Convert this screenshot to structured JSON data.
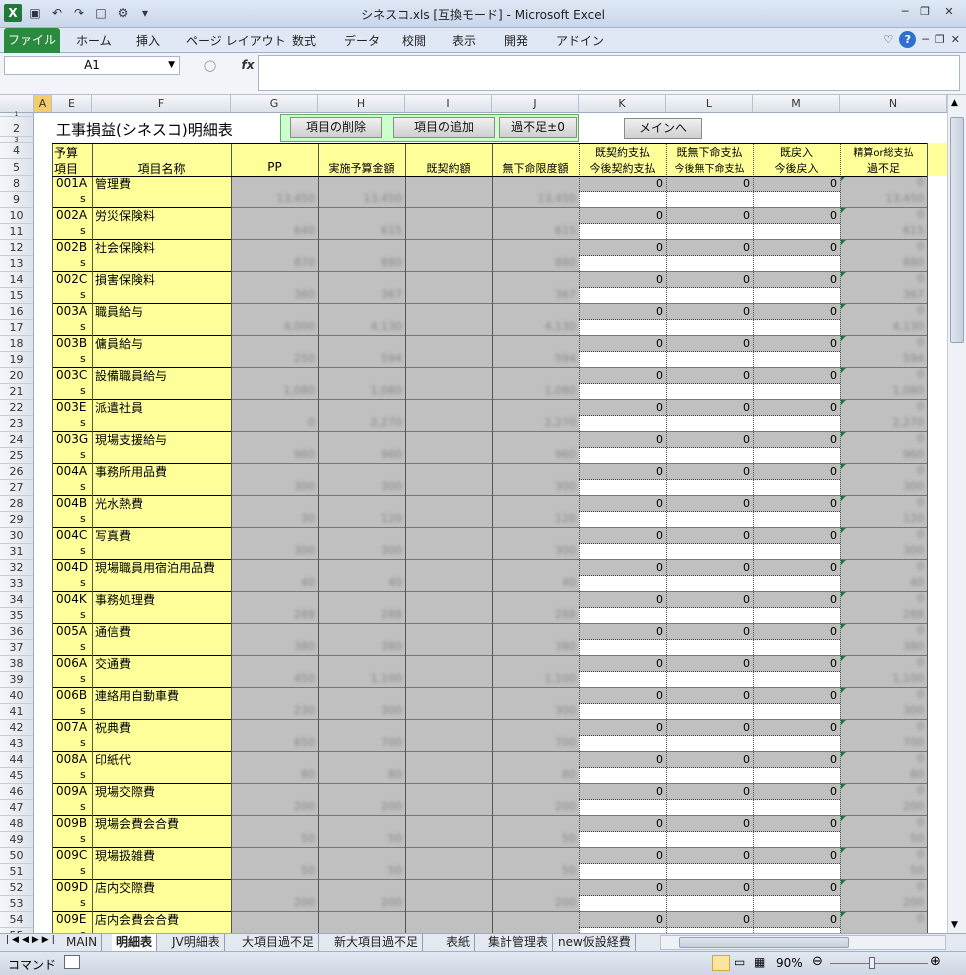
{
  "window": {
    "title": "シネスコ.xls  [互換モード]  -  Microsoft Excel",
    "qat_icons": [
      "excel-app-icon",
      "save-icon",
      "undo-icon",
      "redo-icon",
      "new-doc-icon",
      "form-tool-icon",
      "customize-qat-icon"
    ]
  },
  "ribbon": {
    "file_tab": "ファイル",
    "tabs": [
      "ホーム",
      "挿入",
      "ページ レイアウト",
      "数式",
      "データ",
      "校閲",
      "表示",
      "開発",
      "アドイン"
    ]
  },
  "formula_bar": {
    "name_box": "A1",
    "fx_label": "fx",
    "content": ""
  },
  "sheet": {
    "columns": [
      "A",
      "E",
      "F",
      "G",
      "H",
      "I",
      "J",
      "K",
      "L",
      "M",
      "N"
    ],
    "selected_column": "A",
    "title": "工事損益(シネスコ)明細表",
    "buttons": {
      "delete_item": "項目の削除",
      "add_item": "項目の追加",
      "surplus": "過不足±0",
      "main": "メインへ"
    },
    "headers": {
      "e_top": "予算",
      "e_bottom": "項目",
      "f": "項目名称",
      "g": "PP",
      "h": "実施予算金額",
      "i": "既契約額",
      "j": "無下命限度額",
      "k_top": "既契約支払",
      "k_bottom": "今後契約支払",
      "l_top": "既無下命支払",
      "l_bottom": "今後無下命支払",
      "m_top": "既戻入",
      "m_bottom": "今後戻入",
      "n_top": "精算or総支払",
      "n_bottom": "過不足"
    },
    "header_row_labels": [
      "1",
      "2",
      "3",
      "4",
      "5"
    ],
    "suffix_s": "s",
    "zero_value": "0",
    "items": [
      {
        "row": "8",
        "code": "001A",
        "name": "管理費",
        "g": "13,450",
        "h": "13,450",
        "j": "13,450",
        "n": "13,450"
      },
      {
        "row": "10",
        "code": "002A",
        "name": "労災保険料",
        "g": "640",
        "h": "615",
        "j": "615",
        "n": "615"
      },
      {
        "row": "12",
        "code": "002B",
        "name": "社会保険料",
        "g": "870",
        "h": "880",
        "j": "880",
        "n": "880"
      },
      {
        "row": "14",
        "code": "002C",
        "name": "損害保険料",
        "g": "360",
        "h": "367",
        "j": "367",
        "n": "367"
      },
      {
        "row": "16",
        "code": "003A",
        "name": "職員給与",
        "g": "4,000",
        "h": "4,130",
        "j": "4,130",
        "n": "4,130"
      },
      {
        "row": "18",
        "code": "003B",
        "name": "傭員給与",
        "g": "250",
        "h": "594",
        "j": "594",
        "n": "594"
      },
      {
        "row": "20",
        "code": "003C",
        "name": "設備職員給与",
        "g": "1,080",
        "h": "1,080",
        "j": "1,080",
        "n": "1,080"
      },
      {
        "row": "22",
        "code": "003E",
        "name": "派遣社員",
        "g": "0",
        "h": "2,270",
        "j": "2,270",
        "n": "2,270"
      },
      {
        "row": "24",
        "code": "003G",
        "name": "現場支援給与",
        "g": "960",
        "h": "960",
        "j": "960",
        "n": "960"
      },
      {
        "row": "26",
        "code": "004A",
        "name": "事務所用品費",
        "g": "300",
        "h": "300",
        "j": "300",
        "n": "300"
      },
      {
        "row": "28",
        "code": "004B",
        "name": "光水熱費",
        "g": "30",
        "h": "120",
        "j": "120",
        "n": "120"
      },
      {
        "row": "30",
        "code": "004C",
        "name": "写真費",
        "g": "300",
        "h": "300",
        "j": "300",
        "n": "300"
      },
      {
        "row": "32",
        "code": "004D",
        "name": "現場職員用宿泊用品費",
        "g": "40",
        "h": "40",
        "j": "40",
        "n": "40"
      },
      {
        "row": "34",
        "code": "004K",
        "name": "事務処理費",
        "g": "288",
        "h": "288",
        "j": "288",
        "n": "288"
      },
      {
        "row": "36",
        "code": "005A",
        "name": "通信費",
        "g": "380",
        "h": "380",
        "j": "380",
        "n": "380"
      },
      {
        "row": "38",
        "code": "006A",
        "name": "交通費",
        "g": "450",
        "h": "1,100",
        "j": "1,100",
        "n": "1,100"
      },
      {
        "row": "40",
        "code": "006B",
        "name": "連絡用自動車費",
        "g": "230",
        "h": "300",
        "j": "300",
        "n": "300"
      },
      {
        "row": "42",
        "code": "007A",
        "name": "祝典費",
        "g": "650",
        "h": "700",
        "j": "700",
        "n": "700"
      },
      {
        "row": "44",
        "code": "008A",
        "name": "印紙代",
        "g": "80",
        "h": "80",
        "j": "80",
        "n": "80"
      },
      {
        "row": "46",
        "code": "009A",
        "name": "現場交際費",
        "g": "200",
        "h": "200",
        "j": "200",
        "n": "200"
      },
      {
        "row": "48",
        "code": "009B",
        "name": "現場会費会合費",
        "g": "50",
        "h": "50",
        "j": "50",
        "n": "50"
      },
      {
        "row": "50",
        "code": "009C",
        "name": "現場扱雑費",
        "g": "50",
        "h": "50",
        "j": "50",
        "n": "50"
      },
      {
        "row": "52",
        "code": "009D",
        "name": "店内交際費",
        "g": "200",
        "h": "200",
        "j": "200",
        "n": "200"
      },
      {
        "row": "54",
        "code": "009E",
        "name": "店内会費会合費",
        "g": "",
        "h": "",
        "j": "",
        "n": ""
      }
    ]
  },
  "sheet_tabs": [
    "MAIN",
    "明細表",
    "JV明細表",
    "大項目過不足",
    "新大項目過不足",
    "表紙",
    "集計管理表",
    "new仮設経費"
  ],
  "active_sheet": "明細表",
  "status": {
    "mode": "コマンド",
    "zoom": "90%"
  }
}
